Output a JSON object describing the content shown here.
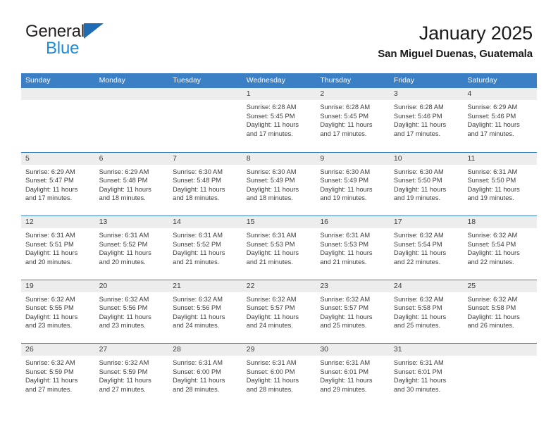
{
  "brand": {
    "name_top": "General",
    "name_bottom": "Blue",
    "triangle_color": "#1f6cb4",
    "blue_color": "#1f8bd8"
  },
  "header": {
    "title": "January 2025",
    "subtitle": "San Miguel Duenas, Guatemala"
  },
  "theme": {
    "header_blue": "#3b7fc4",
    "row_band_gray": "#ededed",
    "text_color": "#3c3c3c"
  },
  "weekdays": [
    "Sunday",
    "Monday",
    "Tuesday",
    "Wednesday",
    "Thursday",
    "Friday",
    "Saturday"
  ],
  "weeks": [
    [
      {
        "day": "",
        "sunrise": "",
        "sunset": "",
        "daylight1": "",
        "daylight2": ""
      },
      {
        "day": "",
        "sunrise": "",
        "sunset": "",
        "daylight1": "",
        "daylight2": ""
      },
      {
        "day": "",
        "sunrise": "",
        "sunset": "",
        "daylight1": "",
        "daylight2": ""
      },
      {
        "day": "1",
        "sunrise": "Sunrise: 6:28 AM",
        "sunset": "Sunset: 5:45 PM",
        "daylight1": "Daylight: 11 hours",
        "daylight2": "and 17 minutes."
      },
      {
        "day": "2",
        "sunrise": "Sunrise: 6:28 AM",
        "sunset": "Sunset: 5:45 PM",
        "daylight1": "Daylight: 11 hours",
        "daylight2": "and 17 minutes."
      },
      {
        "day": "3",
        "sunrise": "Sunrise: 6:28 AM",
        "sunset": "Sunset: 5:46 PM",
        "daylight1": "Daylight: 11 hours",
        "daylight2": "and 17 minutes."
      },
      {
        "day": "4",
        "sunrise": "Sunrise: 6:29 AM",
        "sunset": "Sunset: 5:46 PM",
        "daylight1": "Daylight: 11 hours",
        "daylight2": "and 17 minutes."
      }
    ],
    [
      {
        "day": "5",
        "sunrise": "Sunrise: 6:29 AM",
        "sunset": "Sunset: 5:47 PM",
        "daylight1": "Daylight: 11 hours",
        "daylight2": "and 17 minutes."
      },
      {
        "day": "6",
        "sunrise": "Sunrise: 6:29 AM",
        "sunset": "Sunset: 5:48 PM",
        "daylight1": "Daylight: 11 hours",
        "daylight2": "and 18 minutes."
      },
      {
        "day": "7",
        "sunrise": "Sunrise: 6:30 AM",
        "sunset": "Sunset: 5:48 PM",
        "daylight1": "Daylight: 11 hours",
        "daylight2": "and 18 minutes."
      },
      {
        "day": "8",
        "sunrise": "Sunrise: 6:30 AM",
        "sunset": "Sunset: 5:49 PM",
        "daylight1": "Daylight: 11 hours",
        "daylight2": "and 18 minutes."
      },
      {
        "day": "9",
        "sunrise": "Sunrise: 6:30 AM",
        "sunset": "Sunset: 5:49 PM",
        "daylight1": "Daylight: 11 hours",
        "daylight2": "and 19 minutes."
      },
      {
        "day": "10",
        "sunrise": "Sunrise: 6:30 AM",
        "sunset": "Sunset: 5:50 PM",
        "daylight1": "Daylight: 11 hours",
        "daylight2": "and 19 minutes."
      },
      {
        "day": "11",
        "sunrise": "Sunrise: 6:31 AM",
        "sunset": "Sunset: 5:50 PM",
        "daylight1": "Daylight: 11 hours",
        "daylight2": "and 19 minutes."
      }
    ],
    [
      {
        "day": "12",
        "sunrise": "Sunrise: 6:31 AM",
        "sunset": "Sunset: 5:51 PM",
        "daylight1": "Daylight: 11 hours",
        "daylight2": "and 20 minutes."
      },
      {
        "day": "13",
        "sunrise": "Sunrise: 6:31 AM",
        "sunset": "Sunset: 5:52 PM",
        "daylight1": "Daylight: 11 hours",
        "daylight2": "and 20 minutes."
      },
      {
        "day": "14",
        "sunrise": "Sunrise: 6:31 AM",
        "sunset": "Sunset: 5:52 PM",
        "daylight1": "Daylight: 11 hours",
        "daylight2": "and 21 minutes."
      },
      {
        "day": "15",
        "sunrise": "Sunrise: 6:31 AM",
        "sunset": "Sunset: 5:53 PM",
        "daylight1": "Daylight: 11 hours",
        "daylight2": "and 21 minutes."
      },
      {
        "day": "16",
        "sunrise": "Sunrise: 6:31 AM",
        "sunset": "Sunset: 5:53 PM",
        "daylight1": "Daylight: 11 hours",
        "daylight2": "and 21 minutes."
      },
      {
        "day": "17",
        "sunrise": "Sunrise: 6:32 AM",
        "sunset": "Sunset: 5:54 PM",
        "daylight1": "Daylight: 11 hours",
        "daylight2": "and 22 minutes."
      },
      {
        "day": "18",
        "sunrise": "Sunrise: 6:32 AM",
        "sunset": "Sunset: 5:54 PM",
        "daylight1": "Daylight: 11 hours",
        "daylight2": "and 22 minutes."
      }
    ],
    [
      {
        "day": "19",
        "sunrise": "Sunrise: 6:32 AM",
        "sunset": "Sunset: 5:55 PM",
        "daylight1": "Daylight: 11 hours",
        "daylight2": "and 23 minutes."
      },
      {
        "day": "20",
        "sunrise": "Sunrise: 6:32 AM",
        "sunset": "Sunset: 5:56 PM",
        "daylight1": "Daylight: 11 hours",
        "daylight2": "and 23 minutes."
      },
      {
        "day": "21",
        "sunrise": "Sunrise: 6:32 AM",
        "sunset": "Sunset: 5:56 PM",
        "daylight1": "Daylight: 11 hours",
        "daylight2": "and 24 minutes."
      },
      {
        "day": "22",
        "sunrise": "Sunrise: 6:32 AM",
        "sunset": "Sunset: 5:57 PM",
        "daylight1": "Daylight: 11 hours",
        "daylight2": "and 24 minutes."
      },
      {
        "day": "23",
        "sunrise": "Sunrise: 6:32 AM",
        "sunset": "Sunset: 5:57 PM",
        "daylight1": "Daylight: 11 hours",
        "daylight2": "and 25 minutes."
      },
      {
        "day": "24",
        "sunrise": "Sunrise: 6:32 AM",
        "sunset": "Sunset: 5:58 PM",
        "daylight1": "Daylight: 11 hours",
        "daylight2": "and 25 minutes."
      },
      {
        "day": "25",
        "sunrise": "Sunrise: 6:32 AM",
        "sunset": "Sunset: 5:58 PM",
        "daylight1": "Daylight: 11 hours",
        "daylight2": "and 26 minutes."
      }
    ],
    [
      {
        "day": "26",
        "sunrise": "Sunrise: 6:32 AM",
        "sunset": "Sunset: 5:59 PM",
        "daylight1": "Daylight: 11 hours",
        "daylight2": "and 27 minutes."
      },
      {
        "day": "27",
        "sunrise": "Sunrise: 6:32 AM",
        "sunset": "Sunset: 5:59 PM",
        "daylight1": "Daylight: 11 hours",
        "daylight2": "and 27 minutes."
      },
      {
        "day": "28",
        "sunrise": "Sunrise: 6:31 AM",
        "sunset": "Sunset: 6:00 PM",
        "daylight1": "Daylight: 11 hours",
        "daylight2": "and 28 minutes."
      },
      {
        "day": "29",
        "sunrise": "Sunrise: 6:31 AM",
        "sunset": "Sunset: 6:00 PM",
        "daylight1": "Daylight: 11 hours",
        "daylight2": "and 28 minutes."
      },
      {
        "day": "30",
        "sunrise": "Sunrise: 6:31 AM",
        "sunset": "Sunset: 6:01 PM",
        "daylight1": "Daylight: 11 hours",
        "daylight2": "and 29 minutes."
      },
      {
        "day": "31",
        "sunrise": "Sunrise: 6:31 AM",
        "sunset": "Sunset: 6:01 PM",
        "daylight1": "Daylight: 11 hours",
        "daylight2": "and 30 minutes."
      },
      {
        "day": "",
        "sunrise": "",
        "sunset": "",
        "daylight1": "",
        "daylight2": ""
      }
    ]
  ]
}
